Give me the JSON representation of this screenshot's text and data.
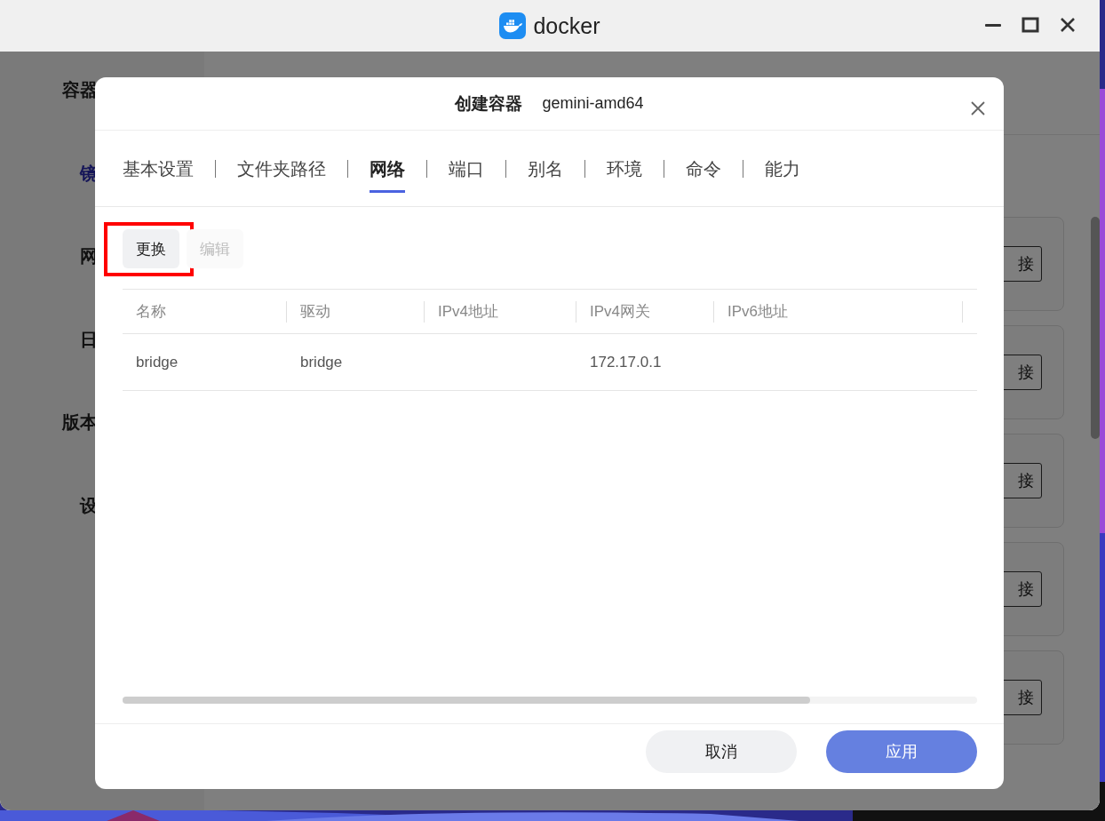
{
  "window": {
    "title": "docker"
  },
  "background": {
    "sidebar": [
      "容器",
      "镜",
      "网",
      "日",
      "版本",
      "设"
    ],
    "cards": [
      {
        "button": "接"
      },
      {
        "button": "接"
      },
      {
        "button": "接"
      },
      {
        "button": "接"
      },
      {
        "button": "接"
      }
    ]
  },
  "dialog": {
    "title": "创建容器",
    "subtitle": "gemini-amd64",
    "tabs": [
      {
        "label": "基本设置",
        "selected": false
      },
      {
        "label": "文件夹路径",
        "selected": false
      },
      {
        "label": "网络",
        "selected": true
      },
      {
        "label": "端口",
        "selected": false
      },
      {
        "label": "别名",
        "selected": false
      },
      {
        "label": "环境",
        "selected": false
      },
      {
        "label": "命令",
        "selected": false
      },
      {
        "label": "能力",
        "selected": false
      }
    ],
    "actions": [
      {
        "label": "更换",
        "disabled": false,
        "highlighted": true
      },
      {
        "label": "编辑",
        "disabled": true,
        "highlighted": false
      }
    ],
    "table": {
      "columns": [
        "名称",
        "驱动",
        "IPv4地址",
        "IPv4网关",
        "IPv6地址"
      ],
      "rows": [
        {
          "cells": [
            "bridge",
            "bridge",
            null,
            "172.17.0.1",
            null
          ]
        }
      ]
    },
    "footer": [
      {
        "label": "取消",
        "kind": "secondary"
      },
      {
        "label": "应用",
        "kind": "primary"
      }
    ]
  }
}
